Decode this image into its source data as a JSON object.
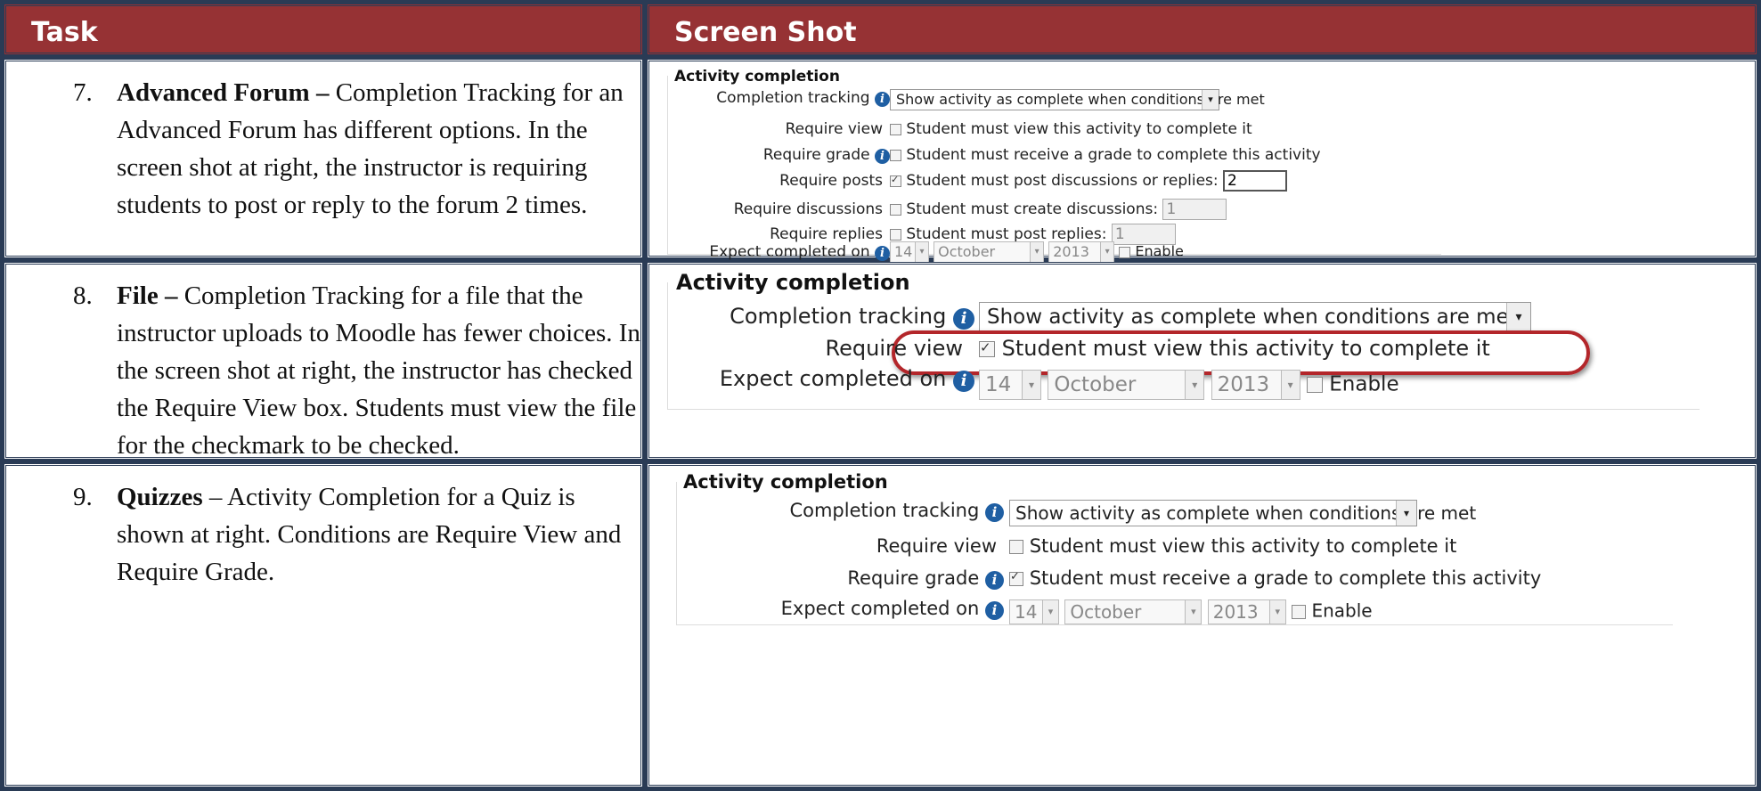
{
  "header": {
    "task": "Task",
    "screenshot": "Screen Shot"
  },
  "rows": [
    {
      "num": "7.",
      "title": "Advanced Forum –",
      "text": " Completion Tracking for an Advanced Forum has different options. In the screen shot at right, the instructor is requiring students to post or reply to the forum 2 times.",
      "shot": {
        "legend": "Activity completion",
        "completion_tracking_label": "Completion tracking",
        "completion_tracking_value": "Show activity as complete when conditions are met",
        "require_view_label": "Require view",
        "require_view_text": "Student must view this activity to complete it",
        "require_grade_label": "Require grade",
        "require_grade_text": "Student must receive a grade to complete this activity",
        "require_posts_label": "Require posts",
        "require_posts_text": "Student must post discussions or replies:",
        "require_posts_value": "2",
        "require_discussions_label": "Require discussions",
        "require_discussions_text": "Student must create discussions:",
        "require_discussions_value": "1",
        "require_replies_label": "Require replies",
        "require_replies_text": "Student must post replies:",
        "require_replies_value": "1",
        "expect_label": "Expect completed on",
        "day": "14",
        "month": "October",
        "year": "2013",
        "enable": "Enable"
      }
    },
    {
      "num": "8.",
      "title": "File –",
      "text": " Completion Tracking for a file that the instructor uploads to Moodle has fewer choices. In the screen shot at right, the instructor has checked the Require View box. Students must view the file for the checkmark to be checked.",
      "shot": {
        "legend": "Activity completion",
        "completion_tracking_label": "Completion tracking",
        "completion_tracking_value": "Show activity as complete when conditions are met",
        "require_view_label": "Require view",
        "require_view_text": "Student must view this activity to complete it",
        "expect_label": "Expect completed on",
        "day": "14",
        "month": "October",
        "year": "2013",
        "enable": "Enable"
      }
    },
    {
      "num": "9.",
      "title": "Quizzes",
      "text": " – Activity Completion for a Quiz is shown at right. Conditions are Require View and Require Grade.",
      "shot": {
        "legend": "Activity completion",
        "completion_tracking_label": "Completion tracking",
        "completion_tracking_value": "Show activity as complete when conditions are met",
        "require_view_label": "Require view",
        "require_view_text": "Student must view this activity to complete it",
        "require_grade_label": "Require grade",
        "require_grade_text": "Student must receive a grade to complete this activity",
        "expect_label": "Expect completed on",
        "day": "14",
        "month": "October",
        "year": "2013",
        "enable": "Enable"
      }
    }
  ],
  "colors": {
    "header_bg": "#963234",
    "border": "#2a3b55",
    "info_icon": "#1f5fa3",
    "highlight_oval": "#b3262a"
  },
  "icons": [
    "info-icon",
    "checkbox-icon",
    "dropdown-arrow-icon"
  ]
}
